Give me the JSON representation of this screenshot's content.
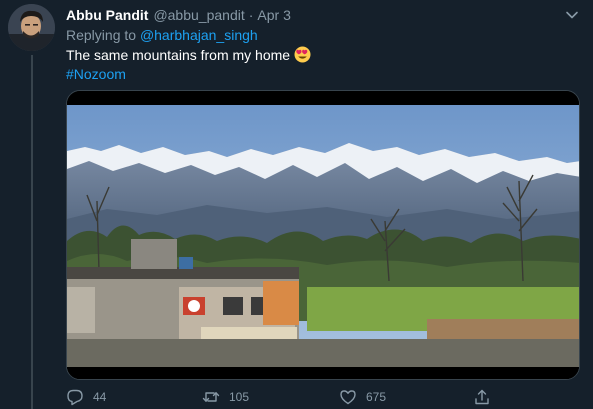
{
  "tweet": {
    "author_name": "Abbu Pandit",
    "handle": "@abbu_pandit",
    "separator": "·",
    "date": "Apr 3",
    "replying_prefix": "Replying to ",
    "replying_to": "@harbhajan_singh",
    "text": "The same mountains from my home",
    "emoji": "heart-eyes-emoji",
    "hashtag": "#Nozoom"
  },
  "actions": {
    "reply_count": "44",
    "retweet_count": "105",
    "like_count": "675"
  },
  "icons": {
    "more": "chevron-down-icon",
    "reply": "reply-icon",
    "retweet": "retweet-icon",
    "like": "heart-icon",
    "share": "share-icon"
  },
  "colors": {
    "background": "#15202b",
    "accent": "#1da1f2",
    "secondary_text": "#8899a6",
    "border": "#38444d"
  }
}
